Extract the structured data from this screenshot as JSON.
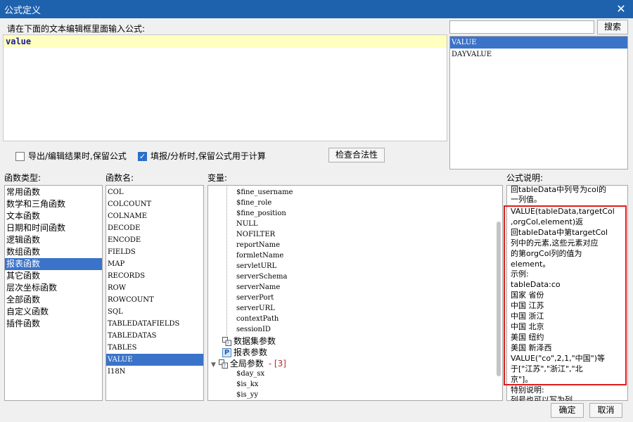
{
  "window": {
    "title": "公式定义"
  },
  "editor": {
    "prompt": "请在下面的文本编辑框里面输入公式:",
    "formula": "value"
  },
  "search": {
    "button": "搜索",
    "results": [
      "VALUE",
      "DAYVALUE"
    ]
  },
  "options": {
    "keep_on_export": "导出/编辑结果时,保留公式",
    "keep_on_fill": "填报/分析时,保留公式用于计算",
    "check_button": "检查合法性"
  },
  "headers": {
    "category": "函数类型:",
    "function": "函数名:",
    "variable": "变量:",
    "description": "公式说明:"
  },
  "categories": [
    "常用函数",
    "数学和三角函数",
    "文本函数",
    "日期和时间函数",
    "逻辑函数",
    "数组函数",
    "报表函数",
    "其它函数",
    "层次坐标函数",
    "全部函数",
    "自定义函数",
    "插件函数"
  ],
  "functions": [
    "COL",
    "COLCOUNT",
    "COLNAME",
    "DECODE",
    "ENCODE",
    "FIELDS",
    "MAP",
    "RECORDS",
    "ROW",
    "ROWCOUNT",
    "SQL",
    "TABLEDATAFIELDS",
    "TABLEDATAS",
    "TABLES",
    "VALUE",
    "I18N"
  ],
  "variables": {
    "params": [
      "$fine_username",
      "$fine_role",
      "$fine_position",
      "NULL",
      "NOFILTER",
      "reportName",
      "formletName",
      "servletURL",
      "serverSchema",
      "serverName",
      "serverPort",
      "serverURL",
      "contextPath",
      "sessionID"
    ],
    "dataset_params": "数据集参数",
    "report_params": "报表参数",
    "global_params": "全局参数",
    "global_marker": "- [3]",
    "global_items": [
      "$day_sx",
      "$is_kx",
      "$is_yy"
    ]
  },
  "description": {
    "lines_top": [
      "回tableData中列号为col的",
      "一列值。"
    ],
    "lines_main": [
      "VALUE(tableData,targetCol",
      ",orgCol,element)返",
      "回tableData中第targetCol",
      "列中的元素,这些元素对应",
      "的第orgCol列的值为",
      "element。",
      "示例:",
      "tableData:co",
      "国家 省份",
      "中国 江苏",
      "中国 浙江",
      "中国 北京",
      "美国 纽约",
      "美国 新泽西",
      "VALUE(\"co\",2,1,\"中国\")等",
      "于[\"江苏\",\"浙江\",\"北",
      "京\"]。"
    ],
    "lines_bottom": [
      "特别说明:",
      "列号也可以写为列"
    ]
  },
  "footer": {
    "ok": "确定",
    "cancel": "取消"
  },
  "colors": {
    "titlebar": "#1e62ae",
    "selection": "#3b73c8",
    "highlight_box": "#e01c1c"
  }
}
